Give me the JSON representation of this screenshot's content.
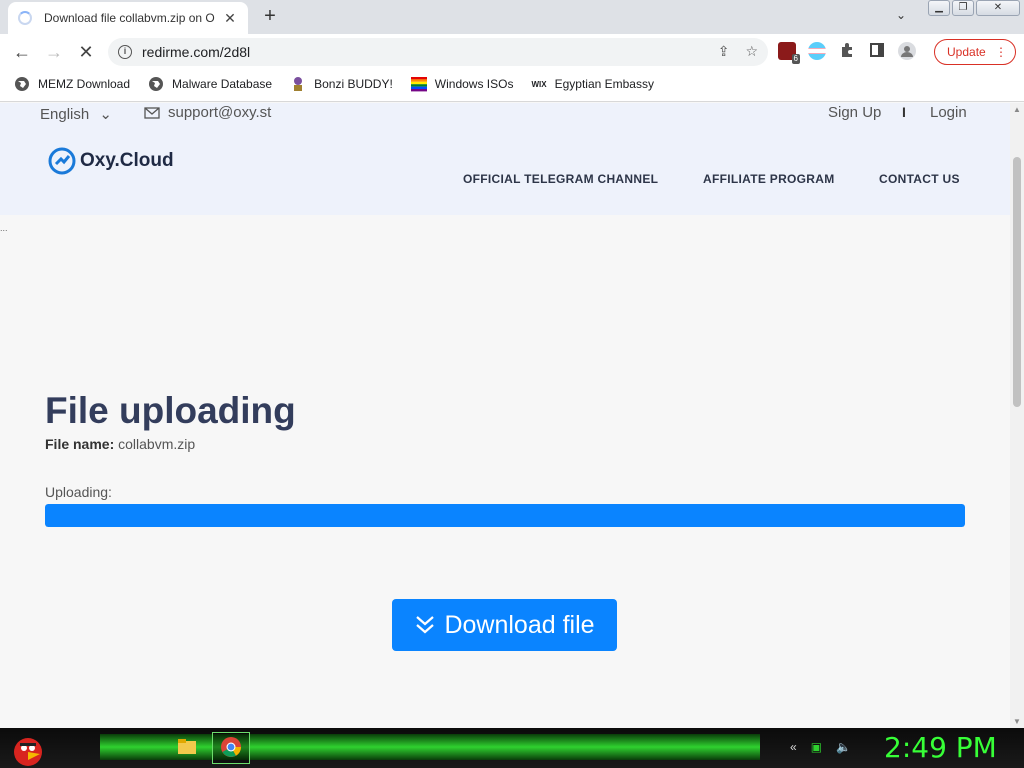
{
  "browser": {
    "tab": {
      "title": "Download file collabvm.zip on O",
      "close": "✕"
    },
    "new_tab": "+",
    "tab_menu": "⌄",
    "window_buttons": {
      "minimize": "▁",
      "restore": "❐",
      "close": "✕"
    },
    "url": "redirme.com/2d8l",
    "nav": {
      "back": "←",
      "forward": "→",
      "reload": "✕"
    },
    "omnibox_actions": {
      "share": "⇪",
      "star": "☆"
    },
    "extensions": [
      "ublock-icon",
      "pride-flag-icon",
      "puzzle-icon",
      "sidepanel-icon",
      "profile-icon"
    ],
    "extension_badge": "6",
    "update_label": "Update",
    "update_menu": "⋮",
    "bookmarks": [
      {
        "label": "MEMZ Download",
        "icon": "globe-icon"
      },
      {
        "label": "Malware Database",
        "icon": "globe-icon"
      },
      {
        "label": "Bonzi BUDDY!",
        "icon": "bonzi-icon"
      },
      {
        "label": "Windows ISOs",
        "icon": "windows-icon"
      },
      {
        "label": "Egyptian Embassy",
        "icon": "wix-icon"
      }
    ],
    "wix_text": "WIX"
  },
  "site": {
    "language": "English",
    "language_chevron": "⌄",
    "support_email": "support@oxy.st",
    "sign_up": "Sign Up",
    "separator": "I",
    "login": "Login",
    "logo_text": "Oxy.Cloud",
    "nav": [
      "OFFICIAL TELEGRAM CHANNEL",
      "AFFILIATE PROGRAM",
      "CONTACT US"
    ],
    "ellipsis": "...",
    "heading": "File uploading",
    "file_name_label": "File name:",
    "file_name": "collabvm.zip",
    "uploading_label": "Uploading:",
    "progress_fraction": 1.0,
    "download_label": "Download file",
    "accent_color": "#0a84ff"
  },
  "taskbar": {
    "clock": "2:49 PM",
    "clock_color": "#37ff37"
  }
}
